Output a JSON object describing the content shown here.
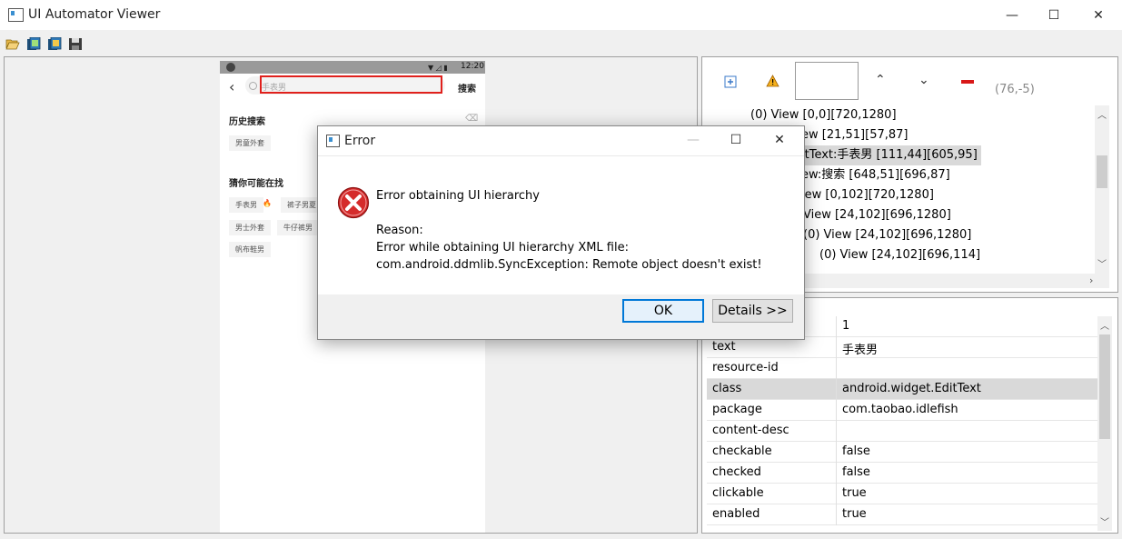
{
  "window": {
    "title": "UI Automator Viewer",
    "minimize": "—",
    "maximize": "☐",
    "close": "✕"
  },
  "toolbar": {
    "open": "open-folder-icon",
    "screenshot": "device-screenshot-icon",
    "screenshot_compressed": "device-screenshot-compressed-icon",
    "save": "save-icon"
  },
  "phone": {
    "status_time": "12:20",
    "search_placeholder": "手表男",
    "search_button": "搜索",
    "history_title": "历史搜索",
    "history_chip": "男童外套",
    "guess_title": "猜你可能在找",
    "chips_row1": [
      "手表男",
      "裤子男夏"
    ],
    "chips_row2": [
      "男士外套",
      "牛仔裤男"
    ],
    "chips_row3": [
      "帆布鞋男"
    ]
  },
  "hierarchy_toolbar": {
    "coords": "(76,-5)"
  },
  "tree": [
    {
      "text": "(0) View [0,0][720,1280]",
      "indent": 52,
      "selected": false
    },
    {
      "text": "ew [21,51][57,87]",
      "indent": 108,
      "selected": false
    },
    {
      "text": "itText:手表男 [111,44][605,95]",
      "indent": 108,
      "selected": true
    },
    {
      "text": "ew:搜索 [648,51][696,87]",
      "indent": 108,
      "selected": false
    },
    {
      "text": "iew [0,102][720,1280]",
      "indent": 108,
      "selected": false
    },
    {
      "text": "View [24,102][696,1280]",
      "indent": 110,
      "selected": false
    },
    {
      "text": "(0) View [24,102][696,1280]",
      "indent": 110,
      "selected": false
    },
    {
      "text": "(0) View [24,102][696,114]",
      "indent": 128,
      "selected": false
    }
  ],
  "properties": [
    {
      "key": "",
      "value": "1",
      "selected": false
    },
    {
      "key": "text",
      "value": "手表男",
      "selected": false
    },
    {
      "key": "resource-id",
      "value": "",
      "selected": false
    },
    {
      "key": "class",
      "value": "android.widget.EditText",
      "selected": true
    },
    {
      "key": "package",
      "value": "com.taobao.idlefish",
      "selected": false
    },
    {
      "key": "content-desc",
      "value": "",
      "selected": false
    },
    {
      "key": "checkable",
      "value": "false",
      "selected": false
    },
    {
      "key": "checked",
      "value": "false",
      "selected": false
    },
    {
      "key": "clickable",
      "value": "true",
      "selected": false
    },
    {
      "key": "enabled",
      "value": "true",
      "selected": false
    }
  ],
  "dialog": {
    "title": "Error",
    "heading": "Error obtaining UI hierarchy",
    "reason_label": "Reason:",
    "reason_line1": "Error while obtaining UI hierarchy XML file:",
    "reason_line2": "com.android.ddmlib.SyncException: Remote object doesn't exist!",
    "ok": "OK",
    "details": "Details >>",
    "minimize": "—",
    "maximize": "☐",
    "close": "✕"
  }
}
